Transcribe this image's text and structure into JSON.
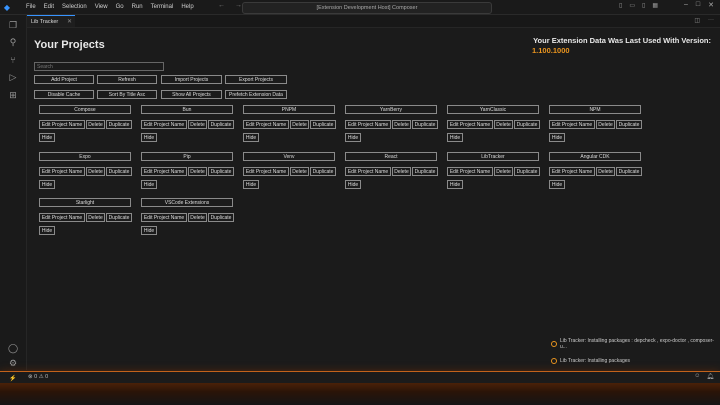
{
  "menu": [
    "File",
    "Edit",
    "Selection",
    "View",
    "Go",
    "Run",
    "Terminal",
    "Help"
  ],
  "window_title": "[Extension Development Host] Composer",
  "tab": {
    "label": "Lib Tracker"
  },
  "page_title": "Your Projects",
  "version": {
    "label": "Your Extension Data Was Last Used With Version:",
    "value": "1.100.1000"
  },
  "search": {
    "placeholder": "Search",
    "value": ""
  },
  "toolbar": {
    "add": "Add Project",
    "refresh": "Refresh",
    "import": "Import Projects",
    "export": "Export Projects",
    "disable_cache": "Disable Cache",
    "sort": "Sort By Title Asc",
    "show_all": "Show All Projects",
    "prefetch": "Prefetch Extension Data"
  },
  "card_buttons": {
    "edit": "Edit Project Name",
    "delete": "Delete",
    "duplicate": "Duplicate",
    "hide": "Hide"
  },
  "projects": [
    "Compose",
    "Bun",
    "PNPM",
    "YarnBerry",
    "YarnClassic",
    "NPM",
    "Expo",
    "Pip",
    "Venv",
    "React",
    "LibTracker",
    "Angular CDK",
    "Starlight",
    "VSCode Extensions"
  ],
  "notifications": [
    "Lib Tracker: Installing packages : depcheck , expo-doctor , composer-u...",
    "Lib Tracker: Installing packages"
  ],
  "status": {
    "problems": "⊗ 0 ⚠ 0"
  },
  "colors": {
    "accent": "#e8941f",
    "status_border": "#c2621b",
    "tab_accent": "#3794ff"
  }
}
